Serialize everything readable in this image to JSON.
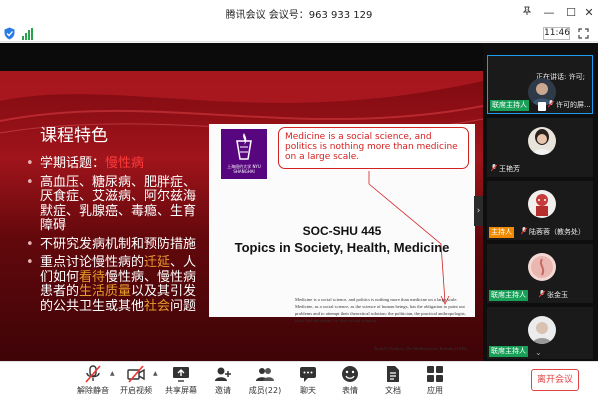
{
  "window": {
    "title": "腾讯会议 会议号：963 933 129"
  },
  "status": {
    "time": "11:46"
  },
  "slide": {
    "title": "课程特色",
    "bullets": [
      {
        "parts": [
          {
            "text": "学期话题：",
            "style": "normal"
          },
          {
            "text": "慢性病",
            "style": "red"
          }
        ]
      },
      {
        "parts": [
          {
            "text": "高血压、糖尿病、肥胖症、厌食症、艾滋病、阿尔兹海默症、乳腺癌、毒瘾、生育障碍",
            "style": "normal"
          }
        ]
      },
      {
        "parts": [
          {
            "text": "不研究发病机制和预防措施",
            "style": "normal"
          }
        ]
      },
      {
        "parts": [
          {
            "text": "重点讨论慢性病的",
            "style": "normal"
          },
          {
            "text": "迁延",
            "style": "orange"
          },
          {
            "text": "、人们如何",
            "style": "normal"
          },
          {
            "text": "看待",
            "style": "orange"
          },
          {
            "text": "慢性病、慢性病患者的",
            "style": "normal"
          },
          {
            "text": "生活质量",
            "style": "orange"
          },
          {
            "text": "以及其引发的公共卫生或其他",
            "style": "normal"
          },
          {
            "text": "社会",
            "style": "orange"
          },
          {
            "text": "问题",
            "style": "normal"
          }
        ]
      }
    ],
    "document": {
      "logo_text": "上海纽约大学 NYU SHANGHAI",
      "callout": "Medicine is a social science, and politics is nothing more than medicine on a large scale.",
      "course_code": "SOC-SHU 445",
      "course_title": "Topics in Society, Health, Medicine",
      "quote": "Medicine is a social science, and politics is nothing more than medicine on a large scale. Medicine, as a social science, as the science of human beings, has the obligation to point out problems and to attempt their theoretical solution: the politician, the practical anthropologist, must find the means for their actual solution.",
      "quote_source": "Rudolf Virchow, Die Medizinische Reform (1848)"
    }
  },
  "participants": {
    "speaking_label": "正在讲话: 许可;",
    "tiles": [
      {
        "badge": "联席主持人",
        "badge_color": "green",
        "name": "许可的屏...",
        "active": true
      },
      {
        "badge": "",
        "badge_color": "",
        "name": "王艳芳",
        "active": false
      },
      {
        "badge": "主持人",
        "badge_color": "orange",
        "name": "陆蓉蓉（教务处）",
        "active": false
      },
      {
        "badge": "联席主持人",
        "badge_color": "green",
        "name": "张金玉",
        "active": false
      },
      {
        "badge": "联席主持人",
        "badge_color": "green",
        "name": "",
        "active": false
      }
    ]
  },
  "toolbar": {
    "unmute": "解除静音",
    "video": "开启视频",
    "share": "共享屏幕",
    "invite": "邀请",
    "members": "成员(22)",
    "chat": "聊天",
    "reactions": "表情",
    "docs": "文档",
    "apps": "应用",
    "end": "离开会议"
  },
  "colors": {
    "accent_blue": "#1e9cf0",
    "host_green": "#18a058",
    "host_orange": "#f08a00",
    "end_red": "#e14444"
  }
}
